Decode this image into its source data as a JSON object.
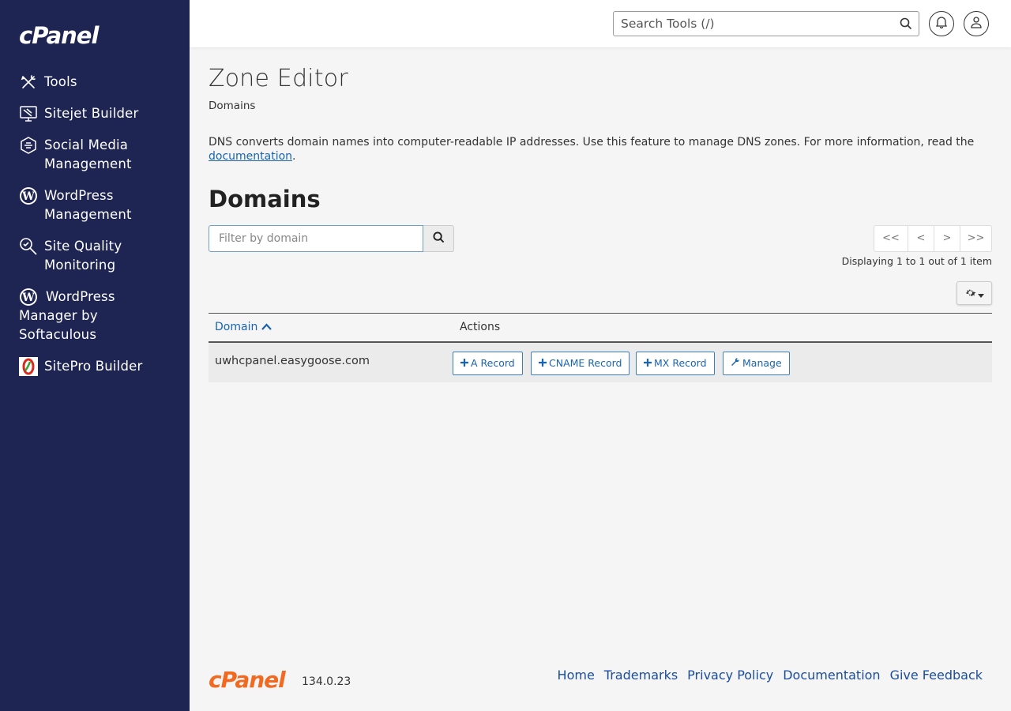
{
  "sidebar": {
    "logo": "cPanel",
    "items": [
      {
        "label": "Tools",
        "icon": "tools-icon"
      },
      {
        "label": "Sitejet Builder",
        "icon": "monitor-icon"
      },
      {
        "label": "Social Media Management",
        "icon": "social-icon"
      },
      {
        "label": "WordPress Management",
        "icon": "wordpress-icon"
      },
      {
        "label": "Site Quality Monitoring",
        "icon": "magnifier-icon"
      },
      {
        "label": "WordPress Manager by Softaculous",
        "icon": "wordpress-icon"
      },
      {
        "label": "SitePro Builder",
        "icon": "sitepro-icon"
      }
    ]
  },
  "header": {
    "search_placeholder": "Search Tools (/)"
  },
  "main": {
    "title": "Zone Editor",
    "breadcrumb": "Domains",
    "description": "DNS converts domain names into computer-readable IP addresses. Use this feature to manage DNS zones. For more information, read the",
    "doc_link": "documentation",
    "section_title": "Domains",
    "filter_placeholder": "Filter by domain",
    "pager": {
      "first": "<<",
      "prev": "<",
      "next": ">",
      "last": ">>"
    },
    "pager_info": "Displaying 1 to 1 out of 1 item",
    "table": {
      "col_domain": "Domain",
      "col_actions": "Actions",
      "rows": [
        {
          "domain": "uwhcpanel.easygoose.com",
          "actions": [
            "A Record",
            "CNAME Record",
            "MX Record",
            "Manage"
          ]
        }
      ]
    }
  },
  "footer": {
    "logo": "cPanel",
    "version": "134.0.23",
    "links": [
      "Home",
      "Trademarks",
      "Privacy Policy",
      "Documentation",
      "Give Feedback"
    ]
  },
  "colors": {
    "sidebar_bg": "#1f2553",
    "link": "#1a64b0",
    "brand_orange": "#f26a21"
  }
}
